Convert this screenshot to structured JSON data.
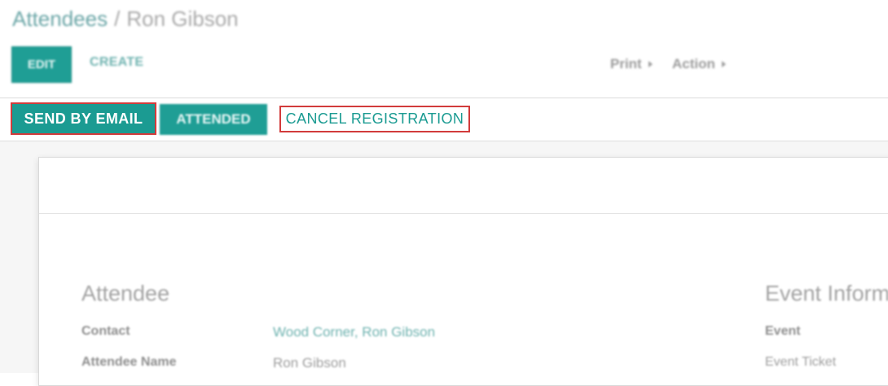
{
  "breadcrumb": {
    "parent": "Attendees",
    "separator": "/",
    "current": "Ron Gibson"
  },
  "toolbar": {
    "edit_label": "EDIT",
    "create_label": "CREATE",
    "print_label": "Print",
    "action_label": "Action"
  },
  "statusbar": {
    "send_email_label": "SEND BY EMAIL",
    "attended_label": "ATTENDED",
    "cancel_label": "CANCEL REGISTRATION"
  },
  "form": {
    "attendee_section_title": "Attendee",
    "event_section_title": "Event Inform",
    "contact_label": "Contact",
    "contact_value": "Wood Corner, Ron Gibson",
    "attendee_name_label": "Attendee Name",
    "attendee_name_value": "Ron Gibson",
    "event_label": "Event",
    "event_ticket_label": "Event Ticket"
  },
  "colors": {
    "primary": "#1b9b92",
    "highlight_border": "#d23b3b",
    "link": "#6fb3b0"
  }
}
